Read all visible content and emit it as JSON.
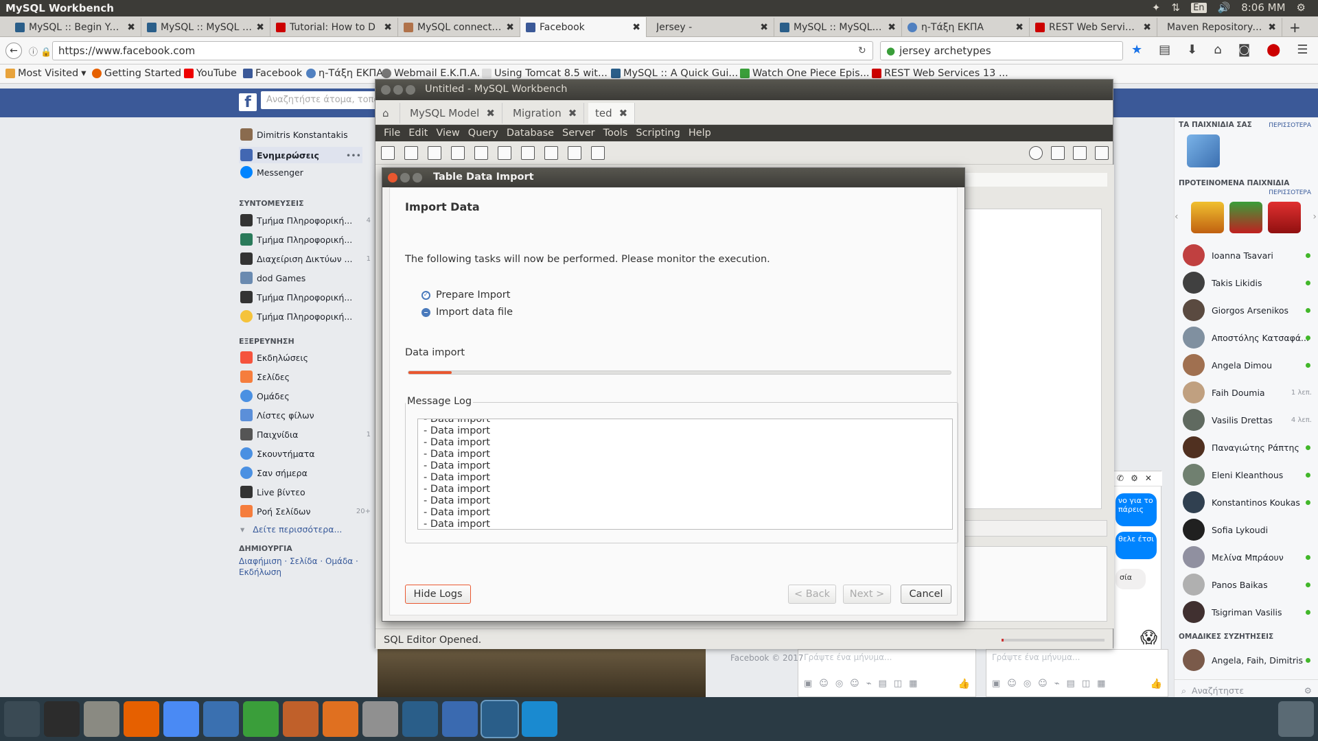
{
  "top_panel": {
    "app_title": "MySQL Workbench",
    "time": "8:06 MM",
    "keyboard": "En"
  },
  "browser": {
    "tabs": [
      {
        "label": "MySQL :: Begin Your",
        "color": "#2a5e89"
      },
      {
        "label": "MySQL :: MySQL Wo",
        "color": "#2a5e89"
      },
      {
        "label": "Tutorial: How to D",
        "color": "#cc0000"
      },
      {
        "label": "MySQL connection",
        "color": "#b0724a"
      },
      {
        "label": "Facebook",
        "color": "#3b5998"
      },
      {
        "label": "Jersey -",
        "color": "#dddddd"
      },
      {
        "label": "MySQL :: MySQL Wo",
        "color": "#2a5e89"
      },
      {
        "label": "η-Τάξη ΕΚΠΑ",
        "color": "#5080c0"
      },
      {
        "label": "REST Web Services",
        "color": "#cc0000"
      },
      {
        "label": "Maven Repository: org",
        "color": "#dddddd"
      }
    ],
    "url": "https://www.facebook.com",
    "search_value": "jersey archetypes",
    "bookmarks": [
      "Most Visited",
      "Getting Started",
      "YouTube",
      "Facebook",
      "η-Τάξη ΕΚΠΑ",
      "Webmail Ε.Κ.Π.Α.",
      "Using Tomcat 8.5 wit...",
      "MySQL :: A Quick Gui...",
      "Watch One Piece Epis...",
      "REST Web Services 13 ..."
    ]
  },
  "facebook": {
    "search_placeholder": "Αναζητήστε άτομα, τοποθεσίες",
    "user_name": "Dimitris Konstantakis",
    "news_feed": "Ενημερώσεις",
    "messenger": "Messenger",
    "shortcuts_header": "ΣΥΝΤΟΜΕΥΣΕΙΣ",
    "shortcuts": [
      {
        "label": "Τμήμα Πληροφορική...",
        "count": "4"
      },
      {
        "label": "Τμήμα Πληροφορική...",
        "count": ""
      },
      {
        "label": "Διαχείριση Δικτύων ...",
        "count": "1"
      },
      {
        "label": "dod Games",
        "count": ""
      },
      {
        "label": "Τμήμα Πληροφορική...",
        "count": ""
      },
      {
        "label": "Τμήμα Πληροφορική...",
        "count": ""
      }
    ],
    "explore_header": "ΕΞΕΡΕΥΝΗΣΗ",
    "explore": [
      {
        "label": "Εκδηλώσεις",
        "count": ""
      },
      {
        "label": "Σελίδες",
        "count": ""
      },
      {
        "label": "Ομάδες",
        "count": ""
      },
      {
        "label": "Λίστες φίλων",
        "count": ""
      },
      {
        "label": "Παιχνίδια",
        "count": "1"
      },
      {
        "label": "Σκουντήματα",
        "count": ""
      },
      {
        "label": "Σαν σήμερα",
        "count": ""
      },
      {
        "label": "Live βίντεο",
        "count": ""
      },
      {
        "label": "Ροή Σελίδων",
        "count": "20+"
      }
    ],
    "see_more": "Δείτε περισσότερα...",
    "create_header": "ΔΗΜΙΟΥΡΓΙΑ",
    "create_links": "Διαφήμιση · Σελίδα · Ομάδα · Εκδήλωση",
    "games_header": "ΤΑ ΠΑΙΧΝΙΔΙΑ ΣΑΣ",
    "more": "ΠΕΡΙΣΣΟΤΕΡΑ",
    "suggested_header": "ΠΡΟΤΕΙΝΟΜΕΝΑ ΠΑΙΧΝΙΔΙΑ",
    "friends": [
      {
        "name": "Ioanna Tsavari",
        "status": ""
      },
      {
        "name": "Takis Likidis",
        "status": ""
      },
      {
        "name": "Giorgos Arsenikos",
        "status": ""
      },
      {
        "name": "Αποστόλης Κατσαφά...",
        "status": ""
      },
      {
        "name": "Angela Dimou",
        "status": ""
      },
      {
        "name": "Faih Doumia",
        "status": "1 λεπ."
      },
      {
        "name": "Vasilis Drettas",
        "status": "4 λεπ."
      },
      {
        "name": "Παναγιώτης Ράπτης",
        "status": ""
      },
      {
        "name": "Eleni Kleanthous",
        "status": ""
      },
      {
        "name": "Konstantinos Koukas",
        "status": ""
      },
      {
        "name": "Sofia Lykoudi",
        "status": ""
      },
      {
        "name": "Μελίνα Μπράουν",
        "status": ""
      },
      {
        "name": "Panos Baikas",
        "status": ""
      },
      {
        "name": "Tsigriman Vasilis",
        "status": ""
      }
    ],
    "group_chats_header": "ΟΜΑΔΙΚΕΣ ΣΥΖΗΤΗΣΕΙΣ",
    "group_chat": "Angela, Faih, Dimitris",
    "chat_search": "Αναζήτηστε",
    "chat_placeholder": "Γράψτε ένα μήνυμα...",
    "chat_bubble_1": "νο για το πάρεις",
    "chat_bubble_2": "θελε έτσι",
    "chat_bubble_3": "σία",
    "footer": "Facebook © 2017"
  },
  "workbench": {
    "window_title": "Untitled - MySQL Workbench",
    "tabs": [
      "MySQL Model",
      "Migration",
      "ted"
    ],
    "menu": [
      "File",
      "Edit",
      "View",
      "Query",
      "Database",
      "Server",
      "Tools",
      "Scripting",
      "Help"
    ],
    "status": "SQL Editor Opened."
  },
  "dialog": {
    "title": "Table Data Import",
    "heading": "Import Data",
    "description": "The following tasks will now be performed. Please monitor the execution.",
    "tasks": [
      {
        "label": "Prepare Import",
        "state": "done"
      },
      {
        "label": "Import data file",
        "state": "running"
      }
    ],
    "progress_label": "Data import",
    "progress_fraction": 0.08,
    "log_label": "Message Log",
    "log_lines": [
      "- Data import",
      "- Data import",
      "- Data import",
      "- Data import",
      "- Data import",
      "- Data import",
      "- Data import",
      "- Data import",
      "- Data import",
      "- Data import"
    ],
    "hide_logs": "Hide Logs",
    "back": "< Back",
    "next": "Next >",
    "cancel": "Cancel",
    "accent": "#e9572f"
  }
}
